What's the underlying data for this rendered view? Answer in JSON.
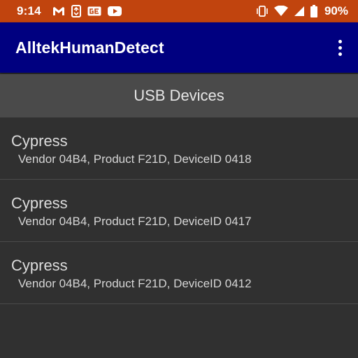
{
  "status_bar": {
    "time": "9:14",
    "battery": "90%",
    "icons_left": [
      "gmail-icon",
      "sync-icon",
      "ge-icon",
      "youtube-icon"
    ],
    "icons_right": [
      "vibrate-icon",
      "wifi-icon",
      "signal-icon",
      "battery-icon"
    ],
    "color": "#c1440e"
  },
  "app_bar": {
    "title": "AlltekHumanDetect",
    "color": "#000080",
    "menu_icon": "overflow-menu-icon"
  },
  "section": {
    "title": "USB Devices"
  },
  "devices": [
    {
      "name": "Cypress",
      "detail": "Vendor 04B4, Product F21D, DeviceID 0418"
    },
    {
      "name": "Cypress",
      "detail": "Vendor 04B4, Product F21D, DeviceID 0417"
    },
    {
      "name": "Cypress",
      "detail": "Vendor 04B4, Product F21D, DeviceID 0412"
    }
  ]
}
